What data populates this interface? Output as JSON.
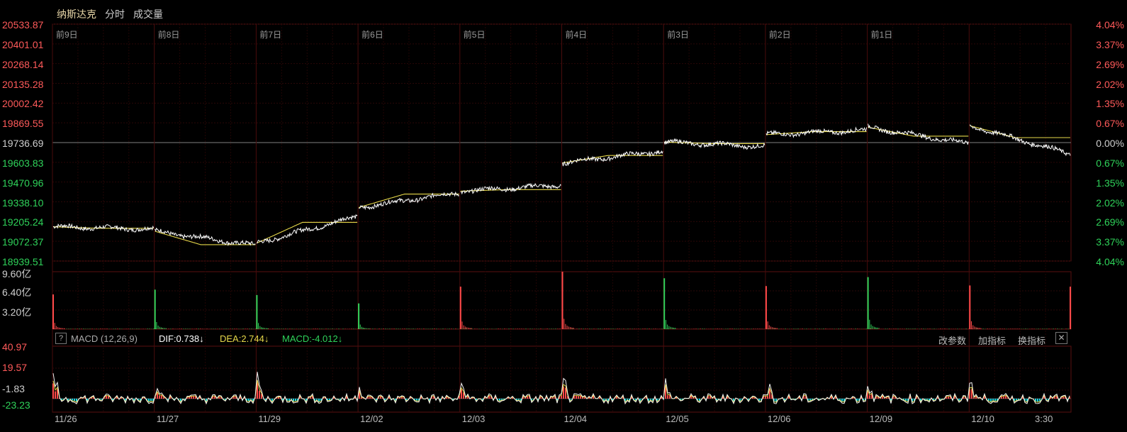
{
  "header": {
    "index_name": "纳斯达克",
    "tab_timeshare": "分时",
    "tab_volume": "成交量"
  },
  "price_axis": {
    "left_labels": [
      "20533.87",
      "20401.01",
      "20268.14",
      "20135.28",
      "20002.42",
      "19869.55",
      "19736.69",
      "19603.83",
      "19470.96",
      "19338.10",
      "19205.24",
      "19072.37",
      "18939.51"
    ],
    "right_labels": [
      "4.04%",
      "3.37%",
      "2.69%",
      "2.02%",
      "1.35%",
      "0.67%",
      "0.00%",
      "0.67%",
      "1.35%",
      "2.02%",
      "2.69%",
      "3.37%",
      "4.04%"
    ],
    "base": 19736.69
  },
  "day_labels": [
    "前9日",
    "前8日",
    "前7日",
    "前6日",
    "前5日",
    "前4日",
    "前3日",
    "前2日",
    "前1日"
  ],
  "volume_axis": {
    "labels": [
      "9.60亿",
      "6.40亿",
      "3.20亿"
    ],
    "max": 9.6
  },
  "macd": {
    "help_label": "?",
    "name": "MACD (12,26,9)",
    "dif": "DIF:0.738",
    "dif_arrow": "↓",
    "dea": "DEA:2.744",
    "dea_arrow": "↓",
    "macd_value": "MACD:-4.012",
    "macd_arrow": "↓",
    "btn_params": "改参数",
    "btn_add": "加指标",
    "btn_switch": "换指标",
    "close_glyph": "✕",
    "axis_labels": [
      "40.97",
      "19.57",
      "-1.83",
      "-23.23"
    ]
  },
  "date_labels": [
    "11/26",
    "11/27",
    "11/29",
    "12/02",
    "12/03",
    "12/04",
    "12/05",
    "12/06",
    "12/09",
    "12/10",
    "3:30"
  ],
  "colors": {
    "up": "#ff4a4a",
    "down": "#2fd35a",
    "price_line": "#ffffff",
    "avg_line": "#e6d84a",
    "macd_neg": "#19d7e6",
    "grid": "#3a0a0a"
  },
  "chart_data": {
    "type": "line",
    "title": "纳斯达克",
    "series": [
      {
        "name": "分时",
        "values": [
          {
            "day": "11/26",
            "open": 19170,
            "close": 19155,
            "avg": 19160
          },
          {
            "day": "11/27",
            "open": 19140,
            "close": 19045,
            "avg": 19050
          },
          {
            "day": "11/29",
            "open": 19060,
            "close": 19240,
            "avg": 19200
          },
          {
            "day": "12/02",
            "open": 19300,
            "close": 19400,
            "avg": 19390
          },
          {
            "day": "12/03",
            "open": 19410,
            "close": 19450,
            "avg": 19420
          },
          {
            "day": "12/04",
            "open": 19600,
            "close": 19680,
            "avg": 19650
          },
          {
            "day": "12/05",
            "open": 19740,
            "close": 19710,
            "avg": 19730
          },
          {
            "day": "12/06",
            "open": 19790,
            "close": 19820,
            "avg": 19810
          },
          {
            "day": "12/09",
            "open": 19840,
            "close": 19730,
            "avg": 19780
          },
          {
            "day": "12/10",
            "open": 19850,
            "close": 19660,
            "avg": 19770
          }
        ]
      }
    ],
    "ylim": [
      18939.51,
      20533.87
    ],
    "volume_peaks": [
      5.8,
      6.6,
      5.7,
      4.3,
      7.1,
      9.6,
      8.5,
      7.2,
      8.7,
      7.3,
      7.1
    ],
    "volume_peak_colors": [
      "up",
      "down",
      "down",
      "down",
      "up",
      "up",
      "down",
      "up",
      "down",
      "up",
      "up"
    ]
  }
}
